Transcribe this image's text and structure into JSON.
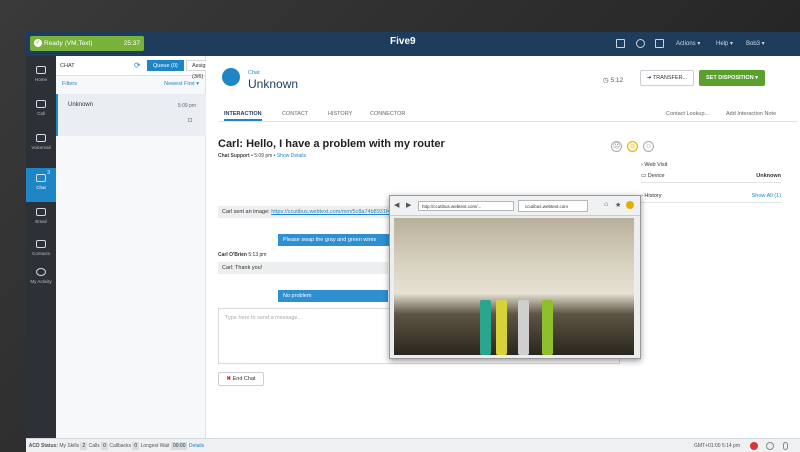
{
  "topbar": {
    "status": "Ready (VM,Text)",
    "status_timer": "25:37",
    "logo": "Five9",
    "actions": "Actions",
    "help": "Help",
    "user": "Bob3"
  },
  "leftnav": [
    {
      "label": "Home",
      "icon": "home-icon"
    },
    {
      "label": "Call",
      "icon": "phone-icon"
    },
    {
      "label": "Voicemail",
      "icon": "voicemail-icon"
    },
    {
      "label": "Chat",
      "icon": "chat-icon",
      "badge": "3"
    },
    {
      "label": "Email",
      "icon": "email-icon"
    },
    {
      "label": "Contacts",
      "icon": "folder-icon"
    },
    {
      "label": "My Activity",
      "icon": "clock-icon"
    }
  ],
  "listpane": {
    "label": "CHAT",
    "queue": "Queue (0)",
    "assigned": "Assigned (3/6)",
    "filters": "Filters",
    "sort": "Newest First",
    "items": [
      {
        "name": "Unknown",
        "time": "5:09 pm"
      }
    ]
  },
  "interaction": {
    "type_label": "Chat",
    "customer_name": "Unknown",
    "timer": "5:12",
    "transfer": "TRANSFER...",
    "set_disposition": "SET DISPOSITION",
    "tabs": [
      "INTERACTION",
      "CONTACT",
      "HISTORY",
      "CONNECTOR"
    ],
    "contact_lookup": "Contact Lookup...",
    "add_note": "Add Interaction Note",
    "subject": "Carl: Hello, I have a problem with my router",
    "sub_source": "Chat Support",
    "sub_time": "• 5:09 pm •",
    "show_details": "Show Details",
    "messages": {
      "m1_prefix": "Carl sent an image:",
      "m1_link": "https://ccutibus.webtext.com/mm/5c8a74b8931f4b35b09b8672",
      "m2": "Please swap the gray and green wires",
      "m3_author": "Carl O'Brien",
      "m3_time": "5:13 pm",
      "m3_text": "Carl: Thank you!",
      "m4": "No problem"
    },
    "compose_placeholder": "Type here to send a message...",
    "end_chat": "End Chat"
  },
  "right": {
    "web_visit": "Web Visit",
    "device_label": "Device",
    "device_value": "Unknown",
    "history": "History",
    "show_all": "Show All (1)"
  },
  "popup": {
    "url": "http://ccutibus.webtext.com/...",
    "tab": "ccutibus.webtext.com"
  },
  "acd": {
    "label": "ACD Status:",
    "skills_label": "My Skills",
    "skills": "2",
    "calls_label": "Calls",
    "calls": "0",
    "callbacks_label": "Callbacks",
    "callbacks": "0",
    "longest_label": "Longest Wait",
    "longest": "00:00",
    "details": "Details",
    "gmt": "GMT+01:00 5:14 pm"
  }
}
